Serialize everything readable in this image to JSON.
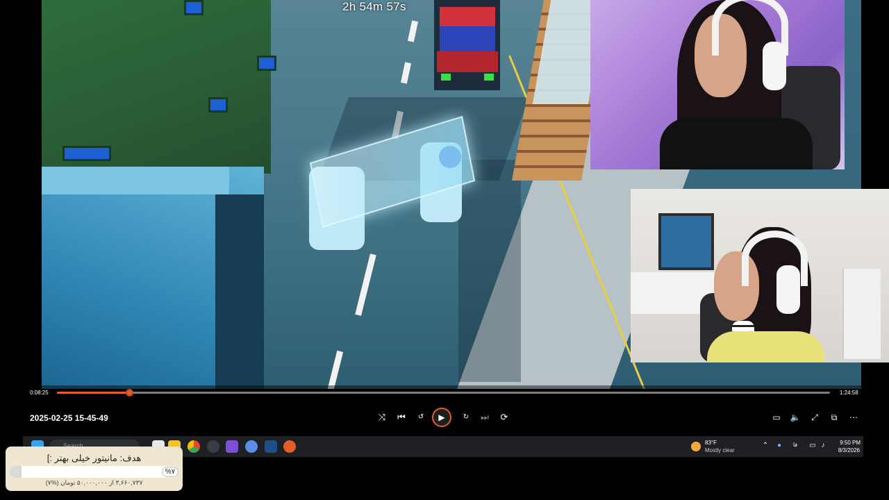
{
  "overlay": {
    "stream_timer": "2h 54m 57s"
  },
  "player": {
    "current_time": "0:08:25",
    "total_time": "1:24:58",
    "progress_fraction": 0.0935,
    "recording_name": "2025-02-25 15-45-49",
    "accent_color": "#e35d2a",
    "controls": {
      "shuffle_icon": "shuffle-icon",
      "previous_icon": "skip-previous-icon",
      "rewind_icon": "rewind-10-icon",
      "play_icon": "play-icon",
      "forward_icon": "forward-30-icon",
      "next_icon": "skip-next-icon",
      "repeat_icon": "repeat-off-icon",
      "miniplayer_icon": "miniplayer-icon",
      "volume_icon": "volume-icon",
      "fullscreen_icon": "fullscreen-icon",
      "cast_icon": "cast-icon",
      "more_icon": "more-icon"
    }
  },
  "taskbar": {
    "search_placeholder": "Search",
    "weather_temp": "83°F",
    "weather_desc": "Mostly clear",
    "time": "9:50 PM",
    "date": "8/3/2026"
  },
  "donation_goal": {
    "title": "هدف: مانیتور خیلی بهتر :]",
    "percent_label": "%۷",
    "progress_fraction": 0.07,
    "amount_text": "۳,۶۶۰,۷۳۷ از ۵۰,۰۰۰,۰۰۰ تومان (%۷)"
  }
}
